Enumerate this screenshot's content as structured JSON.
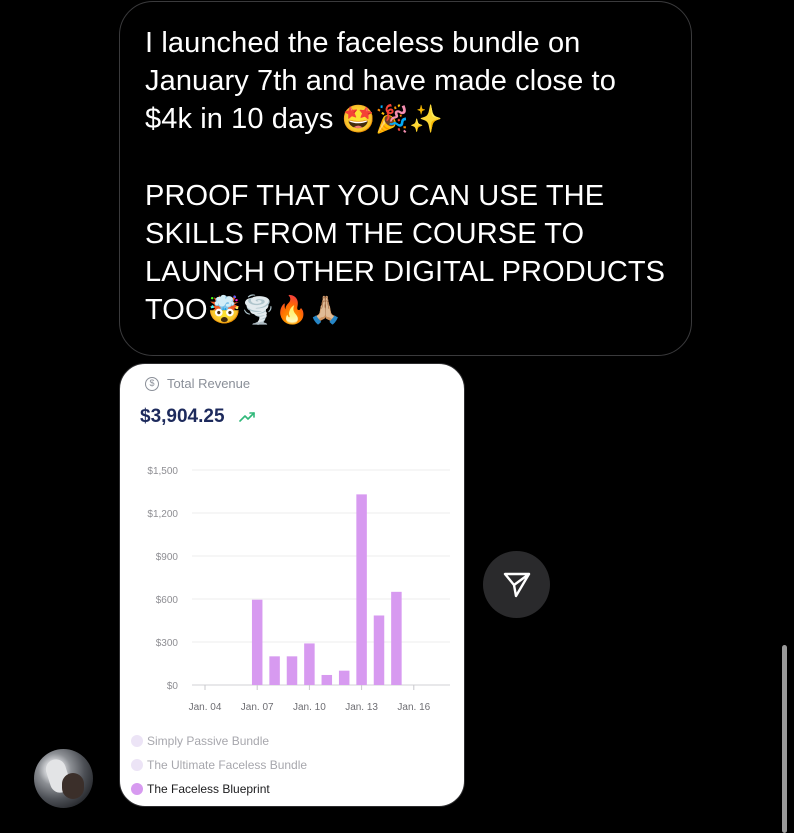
{
  "message": {
    "line1": "I launched the faceless bundle on",
    "line2": "January 7th and have made close to",
    "line3_text": "$4k in 10 days ",
    "line3_emoji": "🤩🎉✨",
    "line4": "PROOF THAT YOU CAN USE THE",
    "line5": "SKILLS FROM THE COURSE TO",
    "line6": "LAUNCH OTHER DIGITAL PRODUCTS",
    "line7_text": "TOO",
    "line7_emoji": "🤯🌪️🔥🙏🏼"
  },
  "revenue_card": {
    "label": "Total Revenue",
    "currency_symbol": "$",
    "value": "$3,904.25",
    "trend_icon": "trending-up-icon",
    "accent_color": "#1d2a5c",
    "trend_color": "#2fb879"
  },
  "chart_data": {
    "type": "bar",
    "x_tick_labels": [
      "Jan. 04",
      "Jan. 07",
      "Jan. 10",
      "Jan. 13",
      "Jan. 16"
    ],
    "y_tick_labels": [
      "$0",
      "$300",
      "$600",
      "$900",
      "$1,200",
      "$1,500"
    ],
    "ylim": [
      0,
      1500
    ],
    "grid": true,
    "bar_color": "#d79af0",
    "series": [
      {
        "name": "The Faceless Blueprint",
        "points": [
          {
            "day": "Jan. 07",
            "value": 595
          },
          {
            "day": "Jan. 08",
            "value": 200
          },
          {
            "day": "Jan. 09",
            "value": 200
          },
          {
            "day": "Jan. 10",
            "value": 290
          },
          {
            "day": "Jan. 11",
            "value": 70
          },
          {
            "day": "Jan. 12",
            "value": 100
          },
          {
            "day": "Jan. 13",
            "value": 1330
          },
          {
            "day": "Jan. 14",
            "value": 485
          },
          {
            "day": "Jan. 15",
            "value": 650
          }
        ]
      }
    ],
    "legend": [
      {
        "name": "Simply Passive Bundle",
        "color": "#ece4f6",
        "text_color": "#a7a7ad"
      },
      {
        "name": "The Ultimate Faceless Bundle",
        "color": "#ece4f6",
        "text_color": "#a7a7ad"
      },
      {
        "name": "The Faceless Blueprint",
        "color": "#d79af0",
        "text_color": "#1c1c1e"
      }
    ]
  },
  "share_button": {
    "icon": "send-icon"
  },
  "avatar": {
    "icon": "profile-photo"
  },
  "colors": {
    "background": "#000000",
    "bubble_border": "#3a3a3c",
    "button_bg": "#2a2a2c"
  }
}
